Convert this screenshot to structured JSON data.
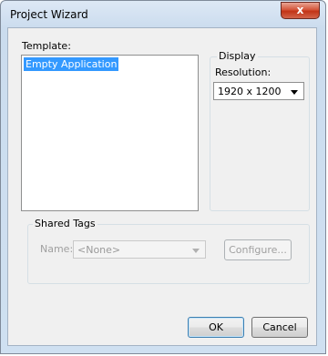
{
  "window": {
    "title": "Project Wizard",
    "close_label": "x"
  },
  "template": {
    "label": "Template:",
    "items": [
      "Empty Application"
    ],
    "selected": "Empty Application"
  },
  "display": {
    "group_label": "Display",
    "resolution_label": "Resolution:",
    "resolution_value": "1920 x 1200"
  },
  "shared_tags": {
    "group_label": "Shared Tags",
    "name_label": "Name:",
    "name_value": "<None>",
    "configure_label": "Configure..."
  },
  "buttons": {
    "ok": "OK",
    "cancel": "Cancel"
  },
  "colors": {
    "selection": "#3399ff",
    "close_red": "#c23417",
    "dialog_bg": "#f0f0f0"
  }
}
